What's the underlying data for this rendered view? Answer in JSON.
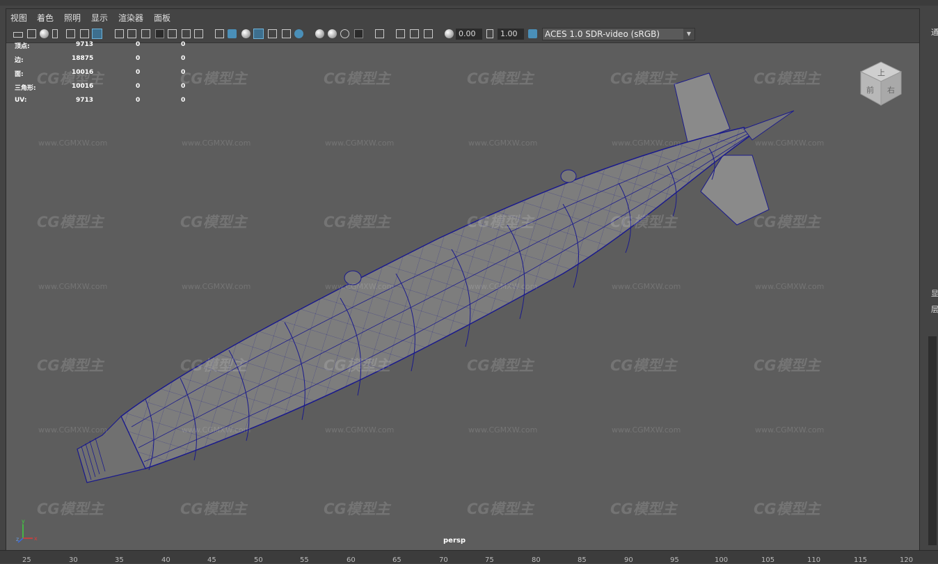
{
  "menu": {
    "items": [
      "视图",
      "着色",
      "照明",
      "显示",
      "渲染器",
      "面板"
    ]
  },
  "toolbar": {
    "exposure_value": "0.00",
    "gamma_value": "1.00",
    "color_space": "ACES 1.0 SDR-video (sRGB)"
  },
  "hud": {
    "rows": [
      {
        "label": "顶点:",
        "v1": "9713",
        "v2": "0",
        "v3": "0"
      },
      {
        "label": "边:",
        "v1": "18875",
        "v2": "0",
        "v3": "0"
      },
      {
        "label": "面:",
        "v1": "10016",
        "v2": "0",
        "v3": "0"
      },
      {
        "label": "三角形:",
        "v1": "10016",
        "v2": "0",
        "v3": "0"
      },
      {
        "label": "UV:",
        "v1": "9713",
        "v2": "0",
        "v3": "0"
      }
    ]
  },
  "viewport": {
    "camera_label": "persp",
    "axis_labels": [
      "y",
      "z",
      "x"
    ],
    "viewcube_labels": [
      "上",
      "前",
      "右"
    ],
    "watermark_logo": "CG模型主",
    "watermark_url": "www.CGMXW.com"
  },
  "right_panel": {
    "labels": [
      "通",
      "显",
      "层"
    ]
  },
  "timeline": {
    "ticks": [
      "25",
      "30",
      "35",
      "40",
      "45",
      "50",
      "55",
      "60",
      "65",
      "70",
      "75",
      "80",
      "85",
      "90",
      "95",
      "100",
      "105",
      "110",
      "115",
      "120"
    ]
  },
  "colors": {
    "viewport_bg": "#5d5d5d",
    "wireframe": "#1a1a8c",
    "mesh_fill": "#7d7d7d",
    "ui_dark": "#444444"
  }
}
